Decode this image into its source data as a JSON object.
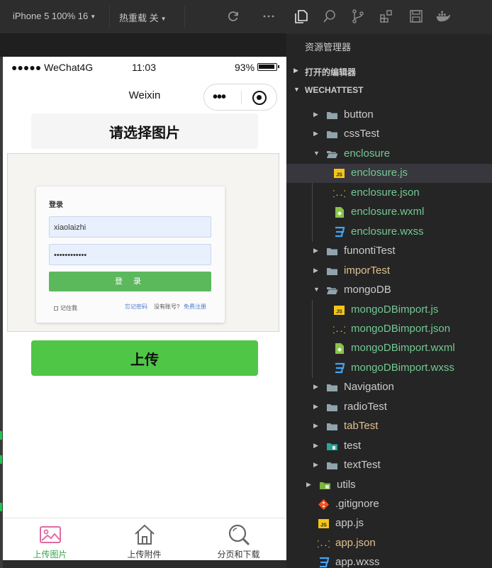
{
  "simulator": {
    "device": "iPhone 5 100% 16",
    "hot_reload": "热重载 关",
    "status": {
      "carrier": "●●●●● WeChat4G",
      "time": "11:03",
      "battery": "93%"
    },
    "nav_title": "Weixin",
    "choose_button": "请选择图片",
    "preview_login": {
      "title": "登录",
      "username": "xiaolaizhi",
      "password": "••••••••••••",
      "login_button": "登 录",
      "remember": "记住我",
      "forgot": "忘记密码",
      "no_account": "没有账号?",
      "register": "免费注册"
    },
    "upload_button": "上传",
    "tabs": [
      {
        "label": "上传图片",
        "icon": "image-icon"
      },
      {
        "label": "上传附件",
        "icon": "home-icon"
      },
      {
        "label": "分页和下载",
        "icon": "search-icon"
      }
    ]
  },
  "explorer": {
    "title": "资源管理器",
    "open_editors": "打开的编辑器",
    "project": "WECHATTEST",
    "tree": [
      {
        "label": "button",
        "type": "folder"
      },
      {
        "label": "cssTest",
        "type": "folder"
      },
      {
        "label": "enclosure",
        "type": "folder-open"
      },
      {
        "label": "enclosure.js",
        "type": "js"
      },
      {
        "label": "enclosure.json",
        "type": "json"
      },
      {
        "label": "enclosure.wxml",
        "type": "wxml"
      },
      {
        "label": "enclosure.wxss",
        "type": "wxss"
      },
      {
        "label": "funontiTest",
        "type": "folder"
      },
      {
        "label": "imporTest",
        "type": "folder"
      },
      {
        "label": "mongoDB",
        "type": "folder-open"
      },
      {
        "label": "mongoDBimport.js",
        "type": "js"
      },
      {
        "label": "mongoDBimport.json",
        "type": "json"
      },
      {
        "label": "mongoDBimport.wxml",
        "type": "wxml"
      },
      {
        "label": "mongoDBimport.wxss",
        "type": "wxss"
      },
      {
        "label": "Navigation",
        "type": "folder"
      },
      {
        "label": "radioTest",
        "type": "folder"
      },
      {
        "label": "tabTest",
        "type": "folder"
      },
      {
        "label": "test",
        "type": "folder-special"
      },
      {
        "label": "textTest",
        "type": "folder"
      },
      {
        "label": "utils",
        "type": "folder-utils"
      },
      {
        "label": ".gitignore",
        "type": "git"
      },
      {
        "label": "app.js",
        "type": "js"
      },
      {
        "label": "app.json",
        "type": "json"
      },
      {
        "label": "app.wxss",
        "type": "wxss"
      }
    ]
  },
  "colors": {
    "upload_green": "#4fc646",
    "active_tab": "#3aa34a",
    "modified_file": "#e2c08d",
    "folder": "#90a4ae",
    "js_yellow": "#f5c518"
  }
}
